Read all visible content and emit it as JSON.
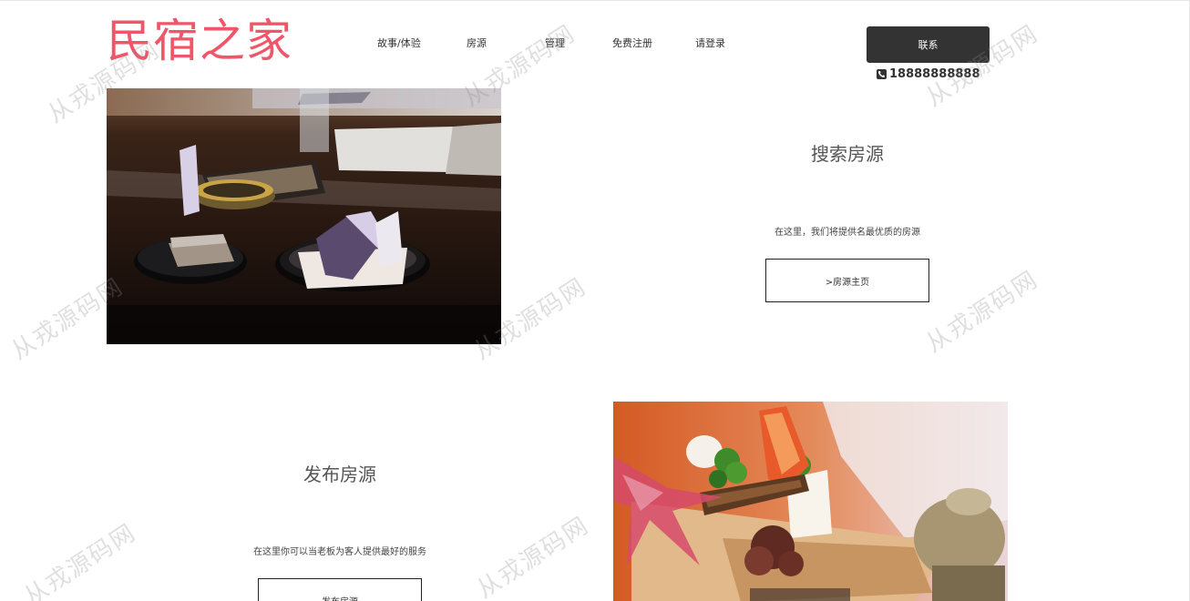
{
  "header": {
    "logo_text": "民宿之家",
    "nav": [
      {
        "label": "故事/体验"
      },
      {
        "label": "房源"
      },
      {
        "label": "管理"
      },
      {
        "label": "免费注册"
      },
      {
        "label": "请登录"
      }
    ],
    "contact_label": "联系",
    "phone": "18888888888"
  },
  "sections": [
    {
      "title": "搜索房源",
      "description": "在这里，我们将提供名最优质的房源",
      "button_label": ">房源主页"
    },
    {
      "title": "发布房源",
      "description": "在这里你可以当老板为客人提供最好的服务",
      "button_label": "发布房源"
    }
  ],
  "watermark_text": "从戎源码网",
  "colors": {
    "logo": "#f0566a",
    "contact_button": "#333333"
  }
}
